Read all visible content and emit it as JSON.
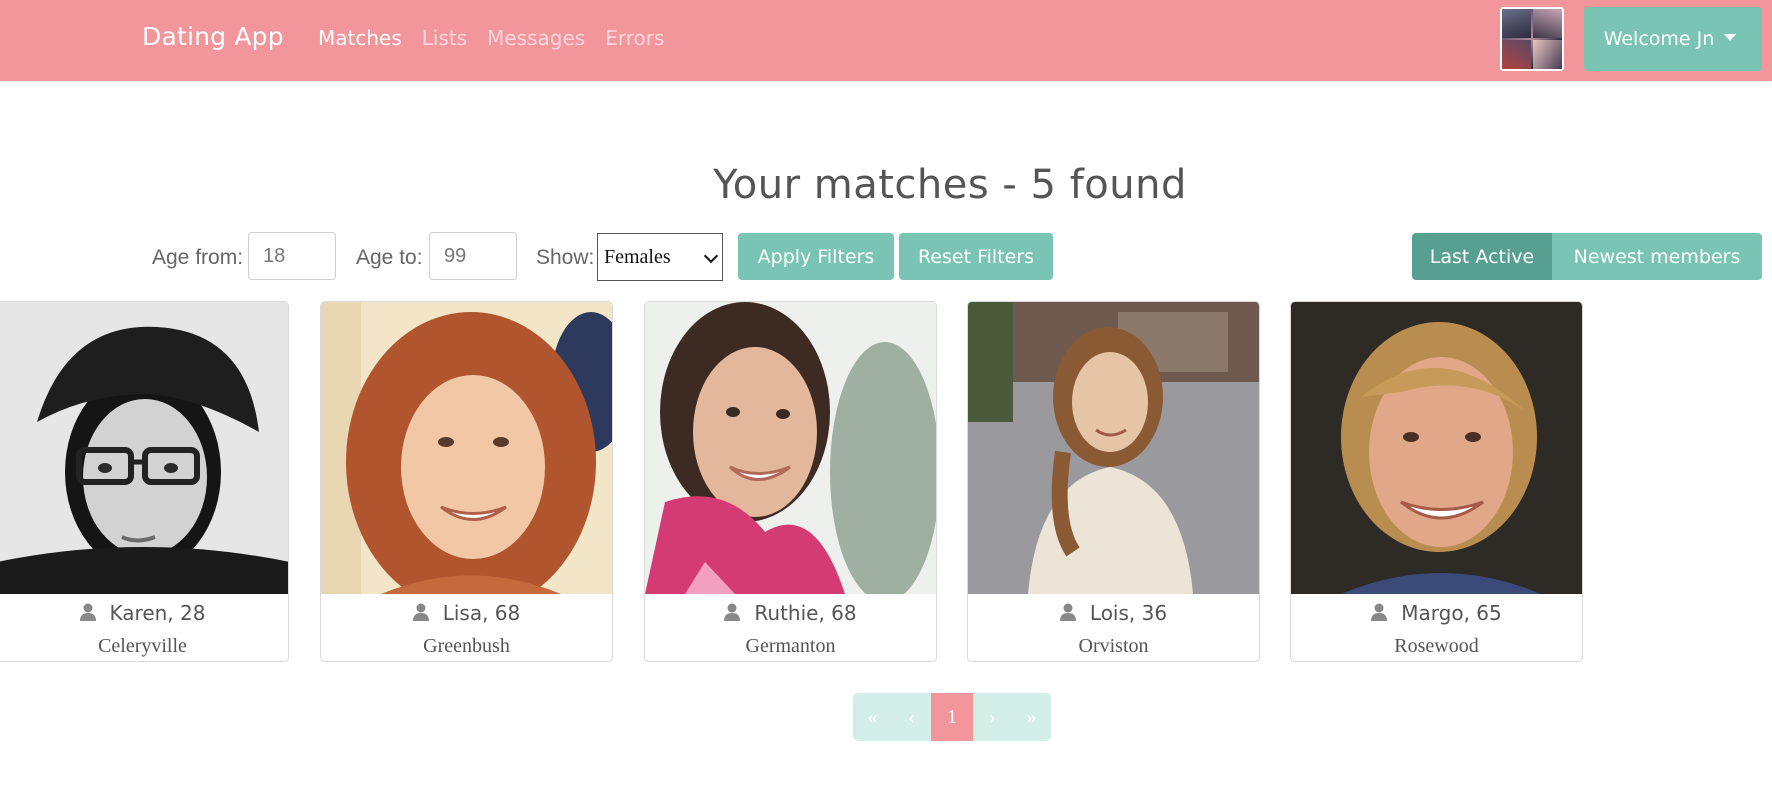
{
  "navbar": {
    "brand": "Dating App",
    "links": [
      {
        "label": "Matches",
        "active": true
      },
      {
        "label": "Lists",
        "active": false
      },
      {
        "label": "Messages",
        "active": false
      },
      {
        "label": "Errors",
        "active": false
      }
    ],
    "welcome": "Welcome Jn"
  },
  "page": {
    "title": "Your matches - 5 found"
  },
  "filters": {
    "age_from_label": "Age from:",
    "age_from_value": "18",
    "age_to_label": "Age to:",
    "age_to_value": "99",
    "show_label": "Show:",
    "show_selected": "Females",
    "apply_label": "Apply Filters",
    "reset_label": "Reset Filters"
  },
  "sort": {
    "options": [
      {
        "label": "Last Active",
        "active": true
      },
      {
        "label": "Newest members",
        "active": false
      }
    ]
  },
  "members": [
    {
      "name_age": "Karen, 28",
      "city": "Celeryville"
    },
    {
      "name_age": "Lisa, 68",
      "city": "Greenbush"
    },
    {
      "name_age": "Ruthie, 68",
      "city": "Germanton"
    },
    {
      "name_age": "Lois, 36",
      "city": "Orviston"
    },
    {
      "name_age": "Margo, 65",
      "city": "Rosewood"
    }
  ],
  "pagination": {
    "first": "«",
    "prev": "‹",
    "current": "1",
    "next": "›",
    "last": "»"
  },
  "colors": {
    "navbar": "#f2969c",
    "accent": "#79c4b2",
    "accent_active": "#57a08f",
    "page_active": "#f2969c"
  }
}
